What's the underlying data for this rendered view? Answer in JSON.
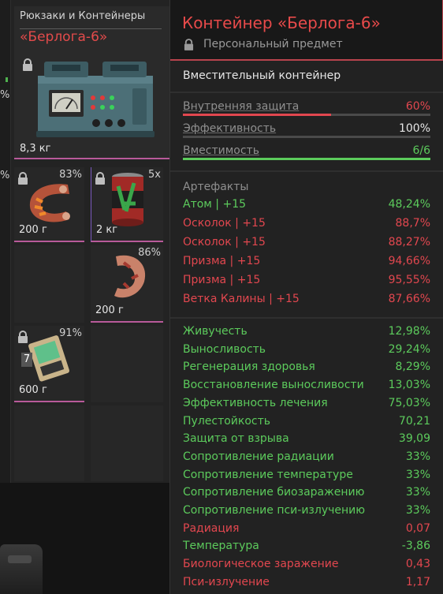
{
  "inventory": {
    "edge_percent_1": "%",
    "edge_percent_2": "%",
    "container": {
      "category": "Рюкзаки и Контейнеры",
      "name": "«Берлога-6»",
      "weight": "8,3 кг",
      "icon": "lock-icon"
    },
    "cells": [
      {
        "name": "artifact-orange",
        "percent": "83%",
        "weight": "200 г",
        "locked": true
      },
      {
        "name": "can",
        "count": "5x",
        "weight": "2 кг",
        "locked": true
      },
      {
        "name": "artifact-pink",
        "percent": "86%",
        "weight": "200 г",
        "locked": false
      },
      {
        "name": "device",
        "percent": "91%",
        "weight": "600 г",
        "locked": true,
        "level": "7"
      }
    ]
  },
  "tooltip": {
    "title": "Контейнер «Берлога-6»",
    "subtitle": "Персональный предмет",
    "type": "Вместительный контейнер",
    "stats": [
      {
        "label": "Внутренняя защита",
        "value": "60%",
        "fill": 0.6,
        "color": "#e2474f"
      },
      {
        "label": "Эффективность",
        "value": "100%",
        "fill": 0,
        "color": "#e6e6e6"
      },
      {
        "label": "Вместимость",
        "value": "6/6",
        "fill": 1.0,
        "color": "#5ccb5c"
      }
    ],
    "artifacts_header": "Артефакты",
    "artifacts": [
      {
        "label": "Атом | +15",
        "value": "48,24%",
        "tone": "g"
      },
      {
        "label": "Осколок | +15",
        "value": "88,7%",
        "tone": "rd"
      },
      {
        "label": "Осколок | +15",
        "value": "88,27%",
        "tone": "rd"
      },
      {
        "label": "Призма | +15",
        "value": "94,66%",
        "tone": "rd"
      },
      {
        "label": "Призма | +15",
        "value": "95,55%",
        "tone": "rd"
      },
      {
        "label": "Ветка Калины | +15",
        "value": "87,66%",
        "tone": "rd"
      }
    ],
    "properties": [
      {
        "label": "Живучесть",
        "value": "12,98%",
        "lt": "g",
        "vt": "g"
      },
      {
        "label": "Выносливость",
        "value": "29,24%",
        "lt": "g",
        "vt": "g"
      },
      {
        "label": "Регенерация здоровья",
        "value": "8,29%",
        "lt": "g",
        "vt": "g"
      },
      {
        "label": "Восстановление выносливости",
        "value": "13,03%",
        "lt": "g",
        "vt": "g"
      },
      {
        "label": "Эффективность лечения",
        "value": "75,03%",
        "lt": "g",
        "vt": "g"
      },
      {
        "label": "Пулестойкость",
        "value": "70,21",
        "lt": "g",
        "vt": "g"
      },
      {
        "label": "Защита от взрыва",
        "value": "39,09",
        "lt": "g",
        "vt": "g"
      },
      {
        "label": "Сопротивление радиации",
        "value": "33%",
        "lt": "g",
        "vt": "g"
      },
      {
        "label": "Сопротивление температуре",
        "value": "33%",
        "lt": "g",
        "vt": "g"
      },
      {
        "label": "Сопротивление биозаражению",
        "value": "33%",
        "lt": "g",
        "vt": "g"
      },
      {
        "label": "Сопротивление пси-излучению",
        "value": "33%",
        "lt": "g",
        "vt": "g"
      },
      {
        "label": "Радиация",
        "value": "0,07",
        "lt": "rd",
        "vt": "rd"
      },
      {
        "label": "Температура",
        "value": "-3,86",
        "lt": "g",
        "vt": "g"
      },
      {
        "label": "Биологическое заражение",
        "value": "0,43",
        "lt": "rd",
        "vt": "rd"
      },
      {
        "label": "Пси-излучение",
        "value": "1,17",
        "lt": "rd",
        "vt": "rd"
      }
    ]
  },
  "colors": {
    "accent_red": "#e2474f",
    "accent_green": "#5ccb5c",
    "panel": "#222222"
  }
}
